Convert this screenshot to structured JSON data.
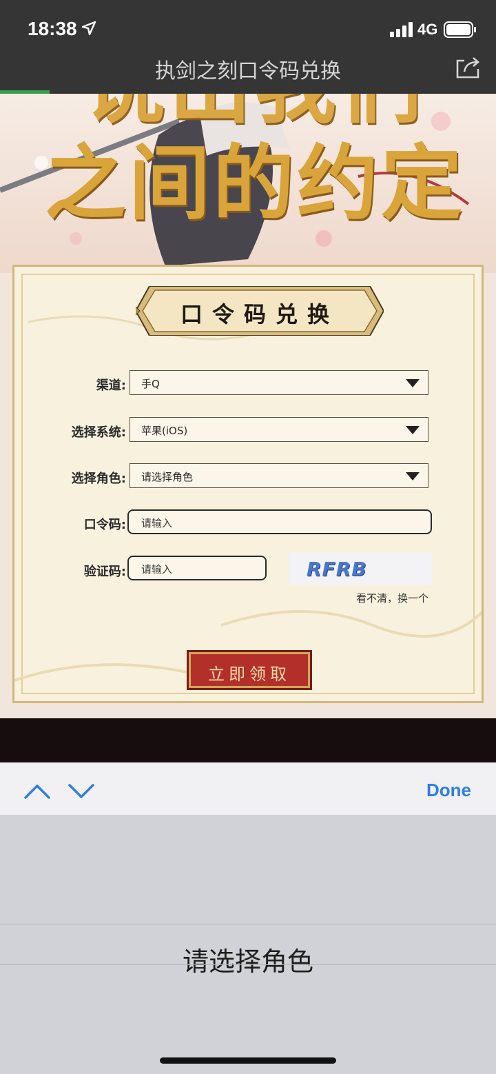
{
  "status_bar": {
    "time": "18:38",
    "network": "4G"
  },
  "nav": {
    "title": "执剑之刻口令码兑换"
  },
  "banner": {
    "line1": "说出我们",
    "line2": "之间的约定"
  },
  "form": {
    "title": "口令码兑换",
    "channel_label": "渠道:",
    "channel_value": "手Q",
    "system_label": "选择系统:",
    "system_value": "苹果(iOS)",
    "role_label": "选择角色:",
    "role_value": "请选择角色",
    "code_label": "口令码:",
    "code_placeholder": "请输入",
    "captcha_label": "验证码:",
    "captcha_placeholder": "请输入",
    "captcha_text": "RFRB",
    "refresh_text": "看不清，换一个",
    "submit_label": "立即领取"
  },
  "accessory": {
    "done_label": "Done"
  },
  "picker": {
    "selected": "请选择角色"
  },
  "colors": {
    "accent": "#2f7de1",
    "button_red": "#b3302a",
    "gold": "#d9a43a"
  }
}
